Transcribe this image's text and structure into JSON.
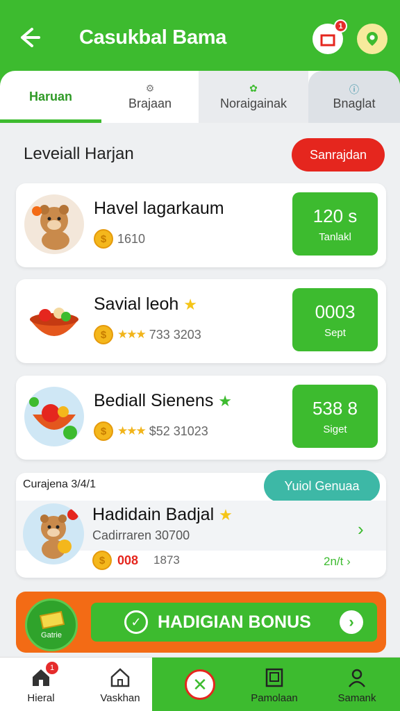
{
  "header": {
    "title": "Casukbal Bama",
    "back_icon": "arrow-left-icon",
    "gift_badge": "1"
  },
  "tabs": [
    {
      "label": "Haruan"
    },
    {
      "label": "Brajaan"
    },
    {
      "label": "Noraigainak"
    },
    {
      "label": "Bnaglat"
    }
  ],
  "section": {
    "title": "Leveiall Harjan",
    "action_label": "Sanrajdan"
  },
  "cards": [
    {
      "name": "Havel lagarkaum",
      "meta": "1610",
      "value": "120 s",
      "sub": "Tanlakl"
    },
    {
      "name": "Savial leoh",
      "meta": "733 3203",
      "value": "0003",
      "sub": "Sept"
    },
    {
      "name": "Bediall Sienens",
      "meta": "$52 31023",
      "value": "538 8",
      "sub": "Siget"
    }
  ],
  "featured": {
    "header": "Curajena 3/4/1",
    "pill": "Yuiol Genuaa",
    "name": "Hadidain Badjal",
    "sub": "Cadirraren 30700",
    "amount": "008",
    "count": "1873",
    "link": "2n/t"
  },
  "promo": {
    "label": "HADIGIAN BONUS",
    "badge": "Gatrie"
  },
  "bottom_nav": [
    {
      "label": "Hieral",
      "badge": "1"
    },
    {
      "label": "Vaskhan"
    },
    {
      "label": ""
    },
    {
      "label": "Pamolaan"
    },
    {
      "label": "Samank"
    }
  ],
  "colors": {
    "primary_green": "#3dbb2f",
    "accent_red": "#e5261e",
    "accent_orange": "#f36b15",
    "accent_teal": "#3db8a6"
  }
}
